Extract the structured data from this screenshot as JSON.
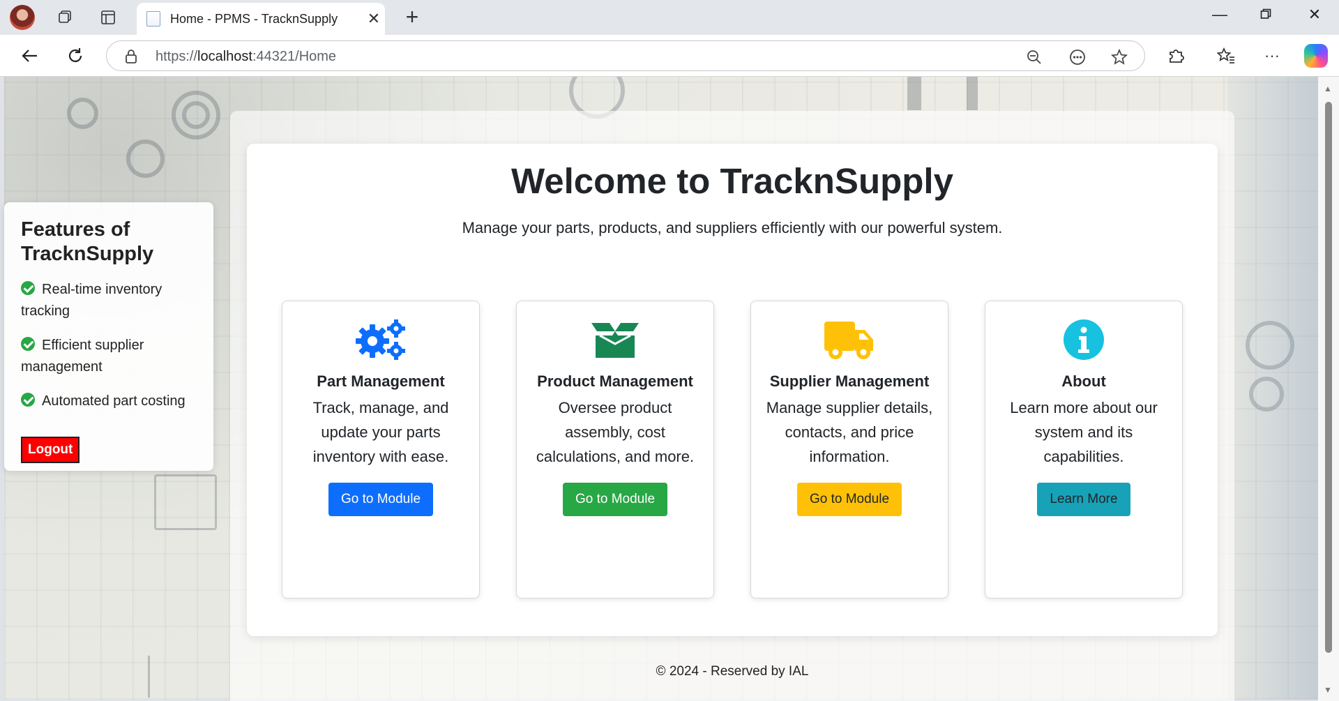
{
  "browser": {
    "tab_title": "Home - PPMS - TracknSupply",
    "url_prefix": "https://",
    "url_host": "localhost",
    "url_rest": ":44321/Home"
  },
  "sidebar": {
    "title": "Features of TracknSupply",
    "features": [
      "Real-time inventory tracking",
      "Efficient supplier management",
      "Automated part costing"
    ],
    "logout_label": "Logout"
  },
  "main": {
    "title": "Welcome to TracknSupply",
    "subtitle": "Manage your parts, products, and suppliers efficiently with our powerful system.",
    "cards": [
      {
        "icon": "gears-icon",
        "title": "Part Management",
        "description": "Track, manage, and update your parts inventory with ease.",
        "button": "Go to Module",
        "color": "#0d6efd"
      },
      {
        "icon": "box-open-icon",
        "title": "Product Management",
        "description": "Oversee product assembly, cost calculations, and more.",
        "button": "Go to Module",
        "color": "#198754"
      },
      {
        "icon": "truck-icon",
        "title": "Supplier Management",
        "description": "Manage supplier details, contacts, and price information.",
        "button": "Go to Module",
        "color": "#ffc107"
      },
      {
        "icon": "info-icon",
        "title": "About",
        "description": "Learn more about our system and its capabilities.",
        "button": "Learn More",
        "color": "#17a2b8"
      }
    ]
  },
  "footer": "© 2024 - Reserved by IAL"
}
